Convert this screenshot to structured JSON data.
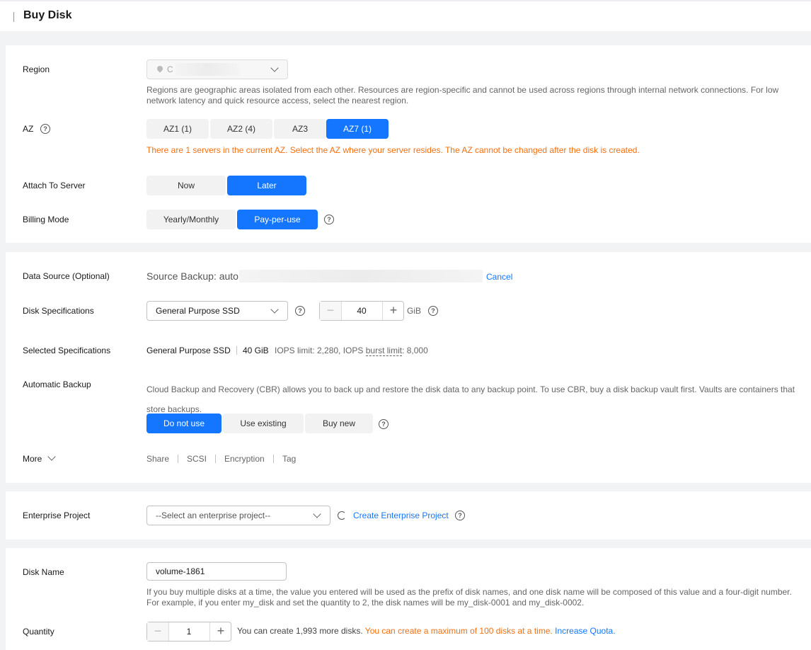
{
  "header": {
    "title": "Buy Disk"
  },
  "region": {
    "label": "Region",
    "value": "C",
    "hint": "Regions are geographic areas isolated from each other. Resources are region-specific and cannot be used across regions through internal network connections. For low network latency and quick resource access, select the nearest region."
  },
  "az": {
    "label": "AZ",
    "options": [
      "AZ1 (1)",
      "AZ2 (4)",
      "AZ3",
      "AZ7 (1)"
    ],
    "selected": "AZ7 (1)",
    "warning": "There are 1 servers in the current AZ. Select the AZ where your server resides. The AZ cannot be changed after the disk is created."
  },
  "attach": {
    "label": "Attach To Server",
    "options": [
      "Now",
      "Later"
    ],
    "selected": "Later"
  },
  "billing": {
    "label": "Billing Mode",
    "options": [
      "Yearly/Monthly",
      "Pay-per-use"
    ],
    "selected": "Pay-per-use"
  },
  "data_source": {
    "label": "Data Source (Optional)",
    "value": "Source Backup: auto",
    "cancel": "Cancel"
  },
  "disk_spec": {
    "label": "Disk Specifications",
    "type": "General Purpose SSD",
    "size": "40",
    "unit": "GiB"
  },
  "selected_spec": {
    "label": "Selected Specifications",
    "type": "General Purpose SSD",
    "size": "40 GiB",
    "iops_prefix": "IOPS limit: 2,280, IOPS",
    "burst_text": "burst limit",
    "burst_value": ": 8,000"
  },
  "backup": {
    "label": "Automatic Backup",
    "hint": "Cloud Backup and Recovery (CBR) allows you to back up and restore the disk data to any backup point. To use CBR, buy a disk backup vault first. Vaults are containers that store backups.",
    "options": [
      "Do not use",
      "Use existing",
      "Buy new"
    ],
    "selected": "Do not use"
  },
  "more": {
    "label": "More",
    "items": [
      "Share",
      "SCSI",
      "Encryption",
      "Tag"
    ]
  },
  "enterprise": {
    "label": "Enterprise Project",
    "placeholder": "--Select an enterprise project--",
    "create": "Create Enterprise Project"
  },
  "disk_name": {
    "label": "Disk Name",
    "value": "volume-1861",
    "hint": "If you buy multiple disks at a time, the value you entered will be used as the prefix of disk names, and one disk name will be composed of this value and a four-digit number. For example, if you enter my_disk and set the quantity to 2, the disk names will be my_disk-0001 and my_disk-0002."
  },
  "quantity": {
    "label": "Quantity",
    "value": "1",
    "remaining": "You can create 1,993 more disks.",
    "max_note": "You can create a maximum of 100 disks at a time.",
    "increase": "Increase Quota."
  },
  "colors": {
    "accent": "#1476ff",
    "warning": "#f66f0f",
    "background": "#f2f3f5"
  }
}
